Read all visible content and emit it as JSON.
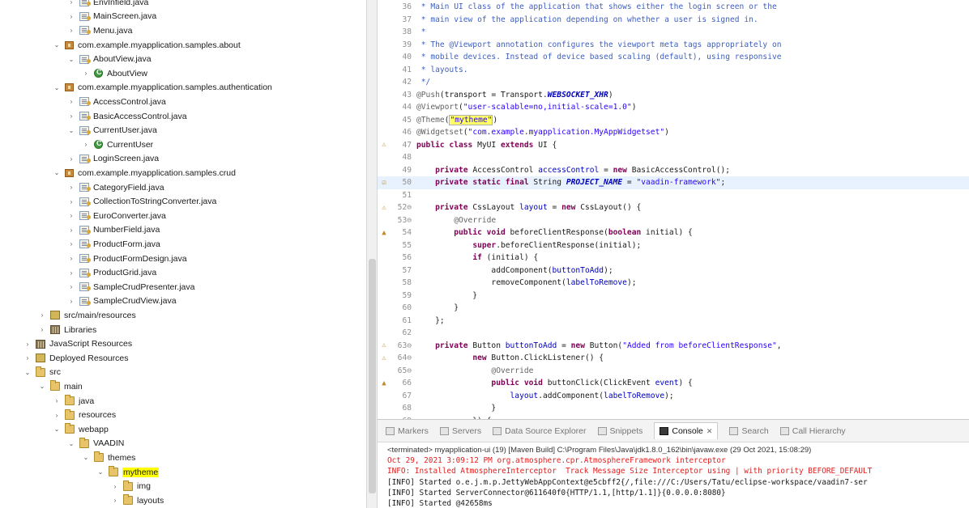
{
  "tree": {
    "rows": [
      {
        "label": "EnvInfield.java",
        "indent": 4,
        "icon": "java",
        "twisty": ">"
      },
      {
        "label": "MainScreen.java",
        "indent": 4,
        "icon": "java",
        "twisty": ">"
      },
      {
        "label": "Menu.java",
        "indent": 4,
        "icon": "java",
        "twisty": ">"
      },
      {
        "label": "com.example.myapplication.samples.about",
        "indent": 3,
        "icon": "pkg",
        "twisty": "v"
      },
      {
        "label": "AboutView.java",
        "indent": 4,
        "icon": "java",
        "twisty": "v"
      },
      {
        "label": "AboutView",
        "indent": 5,
        "icon": "class",
        "twisty": ">"
      },
      {
        "label": "com.example.myapplication.samples.authentication",
        "indent": 3,
        "icon": "pkg",
        "twisty": "v"
      },
      {
        "label": "AccessControl.java",
        "indent": 4,
        "icon": "java",
        "twisty": ">"
      },
      {
        "label": "BasicAccessControl.java",
        "indent": 4,
        "icon": "java",
        "twisty": ">"
      },
      {
        "label": "CurrentUser.java",
        "indent": 4,
        "icon": "java",
        "twisty": "v"
      },
      {
        "label": "CurrentUser",
        "indent": 5,
        "icon": "class",
        "twisty": ">"
      },
      {
        "label": "LoginScreen.java",
        "indent": 4,
        "icon": "java",
        "twisty": ">"
      },
      {
        "label": "com.example.myapplication.samples.crud",
        "indent": 3,
        "icon": "pkg",
        "twisty": "v"
      },
      {
        "label": "CategoryField.java",
        "indent": 4,
        "icon": "java",
        "twisty": ">"
      },
      {
        "label": "CollectionToStringConverter.java",
        "indent": 4,
        "icon": "java",
        "twisty": ">"
      },
      {
        "label": "EuroConverter.java",
        "indent": 4,
        "icon": "java",
        "twisty": ">"
      },
      {
        "label": "NumberField.java",
        "indent": 4,
        "icon": "java",
        "twisty": ">"
      },
      {
        "label": "ProductForm.java",
        "indent": 4,
        "icon": "java",
        "twisty": ">"
      },
      {
        "label": "ProductFormDesign.java",
        "indent": 4,
        "icon": "java",
        "twisty": ">"
      },
      {
        "label": "ProductGrid.java",
        "indent": 4,
        "icon": "java",
        "twisty": ">"
      },
      {
        "label": "SampleCrudPresenter.java",
        "indent": 4,
        "icon": "java",
        "twisty": ">"
      },
      {
        "label": "SampleCrudView.java",
        "indent": 4,
        "icon": "java",
        "twisty": ">"
      },
      {
        "label": "src/main/resources",
        "indent": 2,
        "icon": "res",
        "twisty": ">"
      },
      {
        "label": "Libraries",
        "indent": 2,
        "icon": "lib",
        "twisty": ">"
      },
      {
        "label": "JavaScript Resources",
        "indent": 1,
        "icon": "lib",
        "twisty": ">"
      },
      {
        "label": "Deployed Resources",
        "indent": 1,
        "icon": "res",
        "twisty": ">"
      },
      {
        "label": "src",
        "indent": 1,
        "icon": "folder",
        "twisty": "v"
      },
      {
        "label": "main",
        "indent": 2,
        "icon": "folder",
        "twisty": "v"
      },
      {
        "label": "java",
        "indent": 3,
        "icon": "folder",
        "twisty": ">"
      },
      {
        "label": "resources",
        "indent": 3,
        "icon": "folder",
        "twisty": ">"
      },
      {
        "label": "webapp",
        "indent": 3,
        "icon": "folder",
        "twisty": "v"
      },
      {
        "label": "VAADIN",
        "indent": 4,
        "icon": "folder",
        "twisty": "v"
      },
      {
        "label": "themes",
        "indent": 5,
        "icon": "folder",
        "twisty": "v"
      },
      {
        "label": "mytheme",
        "indent": 6,
        "icon": "folder",
        "twisty": "v",
        "highlight": true
      },
      {
        "label": "img",
        "indent": 7,
        "icon": "folder",
        "twisty": ">"
      },
      {
        "label": "layouts",
        "indent": 7,
        "icon": "folder",
        "twisty": ">"
      }
    ]
  },
  "editor": {
    "lines": [
      {
        "num": "36",
        "marker": "",
        "segs": [
          {
            "t": " * Main UI class of the application that shows either the login screen or the",
            "c": "cm"
          }
        ]
      },
      {
        "num": "37",
        "marker": "",
        "segs": [
          {
            "t": " * main view of the application depending on whether a user is signed in.",
            "c": "cm"
          }
        ]
      },
      {
        "num": "38",
        "marker": "",
        "segs": [
          {
            "t": " *",
            "c": "cm"
          }
        ]
      },
      {
        "num": "39",
        "marker": "",
        "segs": [
          {
            "t": " * The @Viewport annotation configures the viewport meta tags appropriately on",
            "c": "cm"
          }
        ]
      },
      {
        "num": "40",
        "marker": "",
        "segs": [
          {
            "t": " * mobile devices. Instead of device based scaling (default), using responsive",
            "c": "cm"
          }
        ]
      },
      {
        "num": "41",
        "marker": "",
        "segs": [
          {
            "t": " * layouts.",
            "c": "cm"
          }
        ]
      },
      {
        "num": "42",
        "marker": "",
        "segs": [
          {
            "t": " */",
            "c": "cm"
          }
        ]
      },
      {
        "num": "43",
        "marker": "",
        "segs": [
          {
            "t": "@Push",
            "c": "an"
          },
          {
            "t": "(transport = Transport.",
            "c": ""
          },
          {
            "t": "WEBSOCKET_XHR",
            "c": "sfld"
          },
          {
            "t": ")",
            "c": ""
          }
        ]
      },
      {
        "num": "44",
        "marker": "",
        "segs": [
          {
            "t": "@Viewport",
            "c": "an"
          },
          {
            "t": "(",
            "c": ""
          },
          {
            "t": "\"user-scalable=no,initial-scale=1.0\"",
            "c": "st"
          },
          {
            "t": ")",
            "c": ""
          }
        ]
      },
      {
        "num": "45",
        "marker": "",
        "segs": [
          {
            "t": "@Theme",
            "c": "an"
          },
          {
            "t": "(",
            "c": ""
          },
          {
            "t": "\"mytheme\"",
            "c": "st hlbox"
          },
          {
            "t": ")",
            "c": ""
          }
        ]
      },
      {
        "num": "46",
        "marker": "",
        "segs": [
          {
            "t": "@Widgetset",
            "c": "an"
          },
          {
            "t": "(",
            "c": ""
          },
          {
            "t": "\"com.example.myapplication.MyAppWidgetset\"",
            "c": "st"
          },
          {
            "t": ")",
            "c": ""
          }
        ]
      },
      {
        "num": "47",
        "marker": "⚠",
        "segs": [
          {
            "t": "public class ",
            "c": "kw"
          },
          {
            "t": "MyUI ",
            "c": ""
          },
          {
            "t": "extends ",
            "c": "kw"
          },
          {
            "t": "UI {",
            "c": ""
          }
        ]
      },
      {
        "num": "48",
        "marker": "",
        "segs": [
          {
            "t": "",
            "c": ""
          }
        ]
      },
      {
        "num": "49",
        "marker": "",
        "segs": [
          {
            "t": "    ",
            "c": ""
          },
          {
            "t": "private ",
            "c": "kw"
          },
          {
            "t": "AccessControl ",
            "c": ""
          },
          {
            "t": "accessControl",
            "c": "fld"
          },
          {
            "t": " = ",
            "c": ""
          },
          {
            "t": "new ",
            "c": "kw"
          },
          {
            "t": "BasicAccessControl();",
            "c": ""
          }
        ]
      },
      {
        "num": "50",
        "marker": "☑",
        "current": true,
        "segs": [
          {
            "t": "    ",
            "c": ""
          },
          {
            "t": "private static final ",
            "c": "kw"
          },
          {
            "t": "String ",
            "c": ""
          },
          {
            "t": "PROJECT_NAME",
            "c": "sfld"
          },
          {
            "t": " = ",
            "c": ""
          },
          {
            "t": "\"vaadin-framework\"",
            "c": "st"
          },
          {
            "t": ";",
            "c": ""
          }
        ]
      },
      {
        "num": "51",
        "marker": "",
        "segs": [
          {
            "t": "",
            "c": ""
          }
        ]
      },
      {
        "num": "52⊖",
        "marker": "⚠",
        "segs": [
          {
            "t": "    ",
            "c": ""
          },
          {
            "t": "private ",
            "c": "kw"
          },
          {
            "t": "CssLayout ",
            "c": ""
          },
          {
            "t": "layout",
            "c": "fld"
          },
          {
            "t": " = ",
            "c": ""
          },
          {
            "t": "new ",
            "c": "kw"
          },
          {
            "t": "CssLayout() {",
            "c": ""
          }
        ]
      },
      {
        "num": "53⊖",
        "marker": "",
        "segs": [
          {
            "t": "        ",
            "c": ""
          },
          {
            "t": "@Override",
            "c": "an"
          }
        ]
      },
      {
        "num": "54",
        "marker": "▲",
        "segs": [
          {
            "t": "        ",
            "c": ""
          },
          {
            "t": "public void ",
            "c": "kw"
          },
          {
            "t": "beforeClientResponse(",
            "c": ""
          },
          {
            "t": "boolean ",
            "c": "kw"
          },
          {
            "t": "initial) {",
            "c": ""
          }
        ]
      },
      {
        "num": "55",
        "marker": "",
        "segs": [
          {
            "t": "            ",
            "c": ""
          },
          {
            "t": "super",
            "c": "kw"
          },
          {
            "t": ".beforeClientResponse(initial);",
            "c": ""
          }
        ]
      },
      {
        "num": "56",
        "marker": "",
        "segs": [
          {
            "t": "            ",
            "c": ""
          },
          {
            "t": "if ",
            "c": "kw"
          },
          {
            "t": "(initial) {",
            "c": ""
          }
        ]
      },
      {
        "num": "57",
        "marker": "",
        "segs": [
          {
            "t": "                addComponent(",
            "c": ""
          },
          {
            "t": "buttonToAdd",
            "c": "fld"
          },
          {
            "t": ");",
            "c": ""
          }
        ]
      },
      {
        "num": "58",
        "marker": "",
        "segs": [
          {
            "t": "                removeComponent(",
            "c": ""
          },
          {
            "t": "labelToRemove",
            "c": "fld"
          },
          {
            "t": ");",
            "c": ""
          }
        ]
      },
      {
        "num": "59",
        "marker": "",
        "segs": [
          {
            "t": "            }",
            "c": ""
          }
        ]
      },
      {
        "num": "60",
        "marker": "",
        "segs": [
          {
            "t": "        }",
            "c": ""
          }
        ]
      },
      {
        "num": "61",
        "marker": "",
        "segs": [
          {
            "t": "    };",
            "c": ""
          }
        ]
      },
      {
        "num": "62",
        "marker": "",
        "segs": [
          {
            "t": "",
            "c": ""
          }
        ]
      },
      {
        "num": "63⊖",
        "marker": "⚠",
        "segs": [
          {
            "t": "    ",
            "c": ""
          },
          {
            "t": "private ",
            "c": "kw"
          },
          {
            "t": "Button ",
            "c": ""
          },
          {
            "t": "buttonToAdd",
            "c": "fld"
          },
          {
            "t": " = ",
            "c": ""
          },
          {
            "t": "new ",
            "c": "kw"
          },
          {
            "t": "Button(",
            "c": ""
          },
          {
            "t": "\"Added from beforeClientResponse\"",
            "c": "st"
          },
          {
            "t": ",",
            "c": ""
          }
        ]
      },
      {
        "num": "64⊖",
        "marker": "⚠",
        "segs": [
          {
            "t": "            ",
            "c": ""
          },
          {
            "t": "new ",
            "c": "kw"
          },
          {
            "t": "Button.ClickListener() {",
            "c": ""
          }
        ]
      },
      {
        "num": "65⊖",
        "marker": "",
        "segs": [
          {
            "t": "                ",
            "c": ""
          },
          {
            "t": "@Override",
            "c": "an"
          }
        ]
      },
      {
        "num": "66",
        "marker": "▲",
        "segs": [
          {
            "t": "                ",
            "c": ""
          },
          {
            "t": "public void ",
            "c": "kw"
          },
          {
            "t": "buttonClick(ClickEvent ",
            "c": ""
          },
          {
            "t": "event",
            "c": "fld"
          },
          {
            "t": ") {",
            "c": ""
          }
        ]
      },
      {
        "num": "67",
        "marker": "",
        "segs": [
          {
            "t": "                    ",
            "c": ""
          },
          {
            "t": "layout",
            "c": "fld"
          },
          {
            "t": ".addComponent(",
            "c": ""
          },
          {
            "t": "labelToRemove",
            "c": "fld"
          },
          {
            "t": ");",
            "c": ""
          }
        ]
      },
      {
        "num": "68",
        "marker": "",
        "segs": [
          {
            "t": "                }",
            "c": ""
          }
        ]
      },
      {
        "num": "69",
        "marker": "",
        "segs": [
          {
            "t": "            }) {",
            "c": ""
          }
        ]
      }
    ]
  },
  "console": {
    "tabs": [
      {
        "label": "Markers",
        "active": false
      },
      {
        "label": "Servers",
        "active": false
      },
      {
        "label": "Data Source Explorer",
        "active": false
      },
      {
        "label": "Snippets",
        "active": false
      },
      {
        "label": "Console",
        "active": true
      },
      {
        "label": "Search",
        "active": false
      },
      {
        "label": "Call Hierarchy",
        "active": false
      }
    ],
    "lines": [
      {
        "text": "<terminated> myapplication-ui (19) [Maven Build] C:\\Program Files\\Java\\jdk1.8.0_162\\bin\\javaw.exe (29 Oct 2021, 15:08:29)",
        "kind": "term"
      },
      {
        "text": "Oct 29, 2021 3:09:12 PM org.atmosphere.cpr.AtmosphereFramework interceptor",
        "kind": "red"
      },
      {
        "text": "INFO: Installed AtmosphereInterceptor  Track Message Size Interceptor using | with priority BEFORE_DEFAULT",
        "kind": "red"
      },
      {
        "text": "[INFO] Started o.e.j.m.p.JettyWebAppContext@e5cbff2{/,file:///C:/Users/Tatu/eclipse-workspace/vaadin7-ser",
        "kind": "black"
      },
      {
        "text": "[INFO] Started ServerConnector@611640f0{HTTP/1.1,[http/1.1]}{0.0.0.0:8080}",
        "kind": "black"
      },
      {
        "text": "[INFO] Started @42658ms",
        "kind": "black"
      }
    ]
  }
}
